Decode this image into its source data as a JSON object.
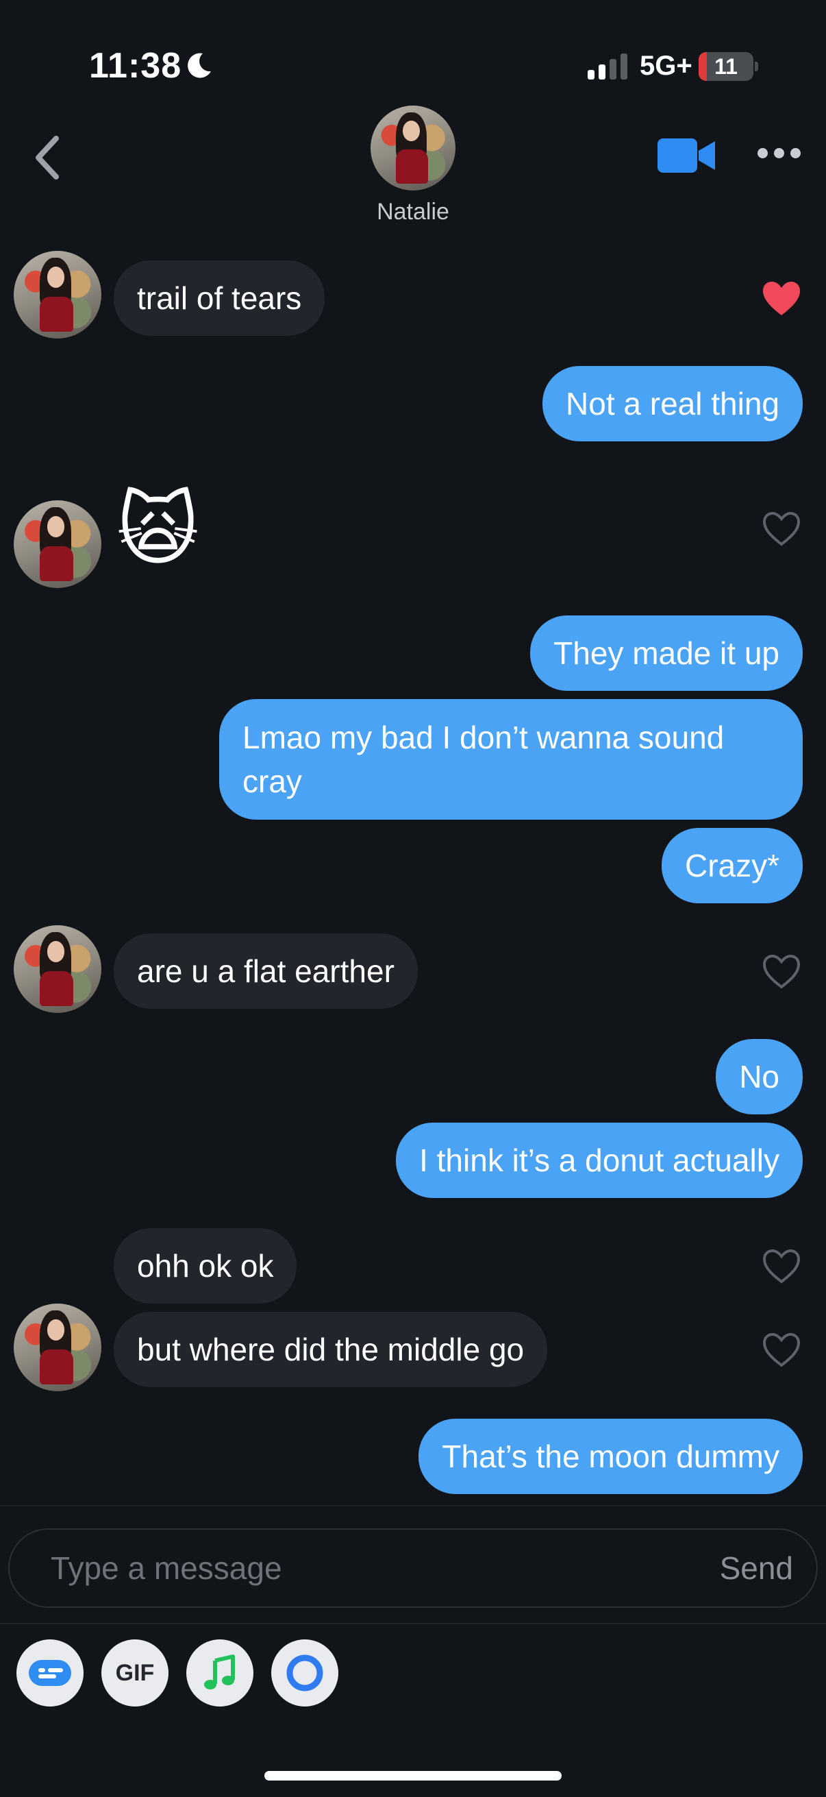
{
  "status_bar": {
    "time": "11:38",
    "network": "5G+",
    "battery": "11"
  },
  "header": {
    "contact_name": "Natalie"
  },
  "messages": [
    {
      "side": "in",
      "text": "trail of tears",
      "liked": true
    },
    {
      "side": "out",
      "text": "Not a real thing"
    },
    {
      "side": "in",
      "text": "🙀",
      "liked": false
    },
    {
      "side": "out",
      "text": "They made it up"
    },
    {
      "side": "out",
      "text": "Lmao my bad I don’t wanna sound cray"
    },
    {
      "side": "out",
      "text": "Crazy*"
    },
    {
      "side": "in",
      "text": "are u a flat earther",
      "liked": false
    },
    {
      "side": "out",
      "text": "No"
    },
    {
      "side": "out",
      "text": "I think it’s a donut actually"
    },
    {
      "side": "in",
      "text": "ohh ok ok",
      "liked": false
    },
    {
      "side": "in",
      "text": "but where did the middle go",
      "liked": false
    },
    {
      "side": "out",
      "text": "That’s the moon dummy"
    }
  ],
  "composer": {
    "placeholder": "Type a message",
    "send_label": "Send"
  },
  "toolbar": {
    "gif_label": "GIF"
  },
  "colors": {
    "outgoing": "#4aa3f5",
    "incoming": "#22252c",
    "liked_heart": "#f24a5a",
    "background": "#111418"
  }
}
